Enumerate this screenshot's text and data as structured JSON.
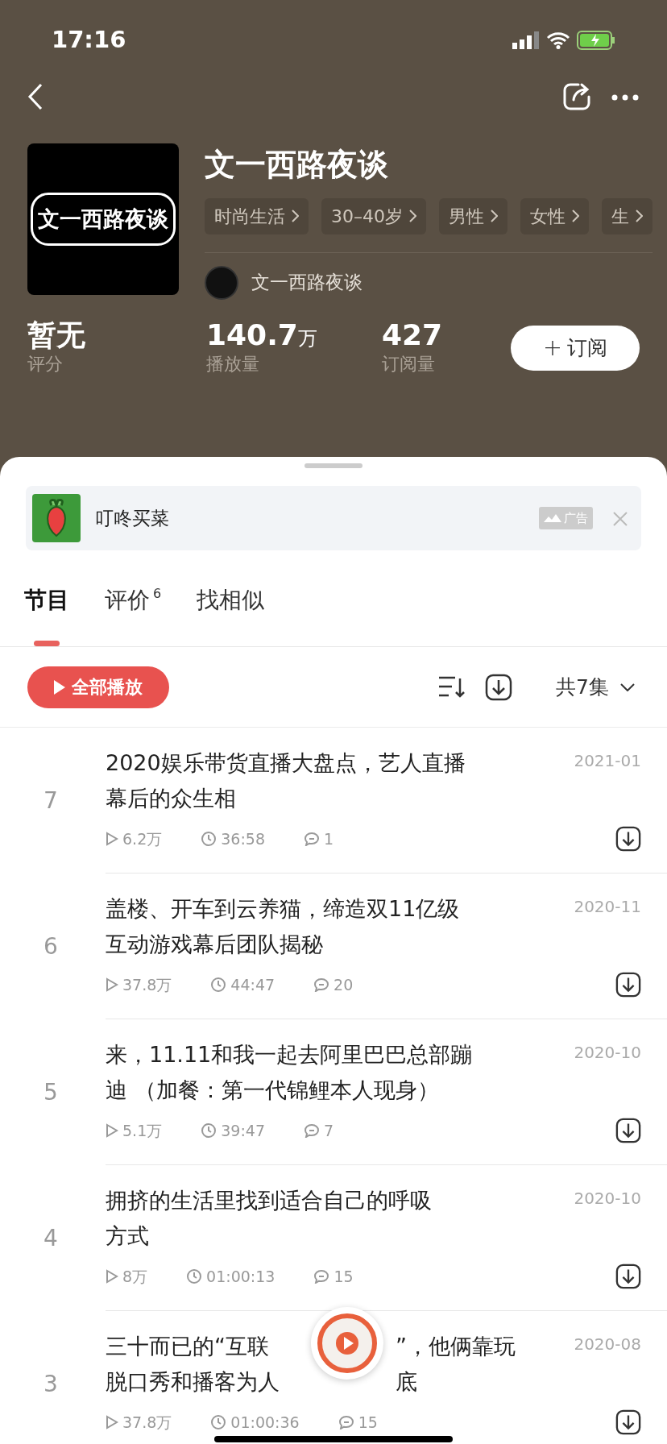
{
  "status_bar": {
    "time": "17:16"
  },
  "podcast": {
    "title": "文一西路夜谈",
    "cover_text": "文一西路夜谈",
    "tags": [
      "时尚生活",
      "30–40岁",
      "男性",
      "女性",
      "生"
    ],
    "author": "文一西路夜谈"
  },
  "stats": [
    {
      "value": "暂无",
      "label": "评分"
    },
    {
      "value": "140.7",
      "unit": "万",
      "label": "播放量"
    },
    {
      "value": "427",
      "label": "订阅量"
    }
  ],
  "subscribe_button": {
    "icon": "+",
    "label": "订阅"
  },
  "ad": {
    "name": "叮咚买菜",
    "tag": "广告"
  },
  "tabs": [
    {
      "label": "节目",
      "selected": true
    },
    {
      "label": "评价",
      "badge": "6",
      "selected": false
    },
    {
      "label": "找相似",
      "selected": false
    }
  ],
  "toolbar": {
    "play_all": "全部播放",
    "count": "共7集"
  },
  "episodes": [
    {
      "number": "7",
      "title_lines": [
        [
          "2020娱乐带货直播大盘点，艺人直播"
        ],
        [
          "幕后的众生相"
        ]
      ],
      "date": "2021-01",
      "plays": "6.2万",
      "duration": "36:58",
      "comments": "1"
    },
    {
      "number": "6",
      "title_lines": [
        [
          "盖楼、开车到云养猫，缔造双11亿级"
        ],
        [
          "互动游戏幕后团队揭秘"
        ]
      ],
      "date": "2020-11",
      "plays": "37.8万",
      "duration": "44:47",
      "comments": "20"
    },
    {
      "number": "5",
      "title_lines": [
        [
          "来，11.11和我一起去阿里巴巴总部蹦"
        ],
        [
          "迪 （加餐：第一代锦鲤本人现身）"
        ]
      ],
      "date": "2020-10",
      "plays": "5.1万",
      "duration": "39:47",
      "comments": "7"
    },
    {
      "number": "4",
      "title_lines": [
        [
          "拥挤的生活里找到适合自己的呼吸"
        ],
        [
          "方式"
        ]
      ],
      "date": "2020-10",
      "plays": "8万",
      "duration": "01:00:13",
      "comments": "15"
    },
    {
      "number": "3",
      "title_lines": [
        [
          "三十而已的“互联",
          "”，他俩靠玩"
        ],
        [
          "脱口秀和播客为人",
          "底"
        ]
      ],
      "date": "2020-08",
      "plays": "37.8万",
      "duration": "01:00:36",
      "comments": "15"
    }
  ]
}
